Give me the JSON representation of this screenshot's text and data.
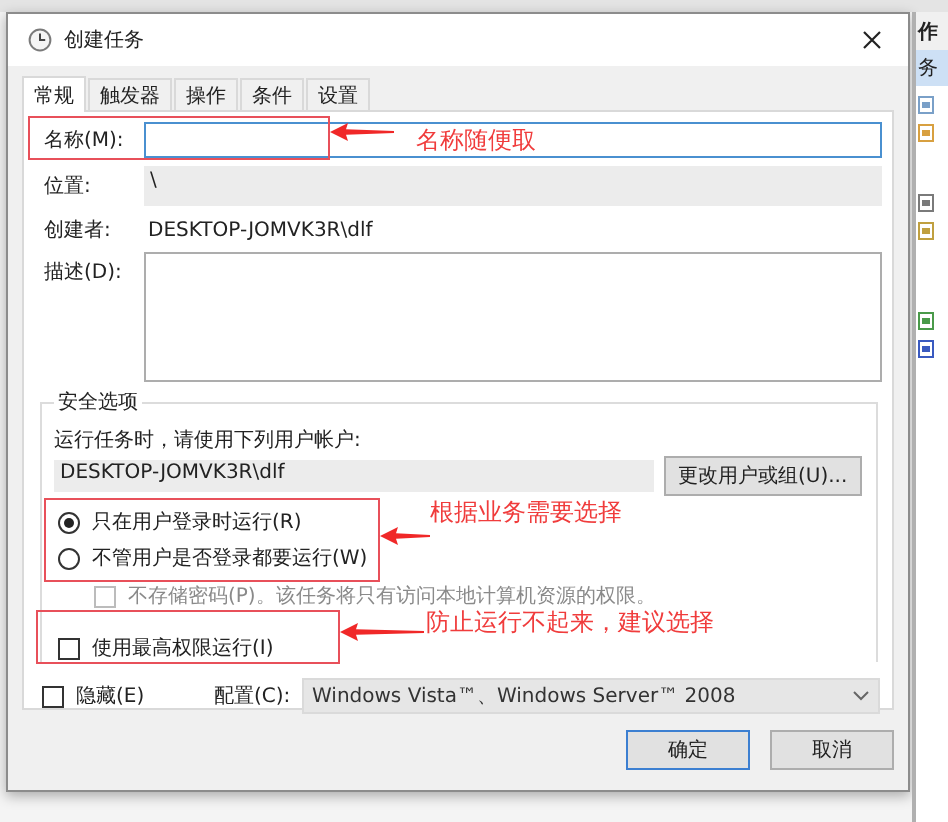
{
  "window": {
    "title": "创建任务"
  },
  "tabs": [
    {
      "label": "常规",
      "selected": true
    },
    {
      "label": "触发器",
      "selected": false
    },
    {
      "label": "操作",
      "selected": false
    },
    {
      "label": "条件",
      "selected": false
    },
    {
      "label": "设置",
      "selected": false
    }
  ],
  "name": {
    "label": "名称(M):",
    "focused": true
  },
  "location": {
    "label": "位置:",
    "value": "\\"
  },
  "author": {
    "label": "创建者:",
    "value": "DESKTOP-JOMVK3R\\dlf"
  },
  "description": {
    "label": "描述(D):"
  },
  "security": {
    "title": "安全选项",
    "prompt": "运行任务时，请使用下列用户帐户:",
    "account": "DESKTOP-JOMVK3R\\dlf",
    "change_button": "更改用户或组(U)...",
    "options": [
      {
        "kind": "radio",
        "label": "只在用户登录时运行(R)",
        "selected": true,
        "disabled": false
      },
      {
        "kind": "radio",
        "label": "不管用户是否登录都要运行(W)",
        "selected": false,
        "disabled": false
      },
      {
        "kind": "checkbox",
        "label": "不存储密码(P)。该任务将只有访问本地计算机资源的权限。",
        "checked": false,
        "disabled": true
      },
      {
        "kind": "checkbox",
        "label": "使用最高权限运行(I)",
        "checked": false,
        "disabled": false
      }
    ]
  },
  "hidden": {
    "label": "隐藏(E)",
    "checked": false
  },
  "configure": {
    "label": "配置(C):",
    "value": "Windows Vista™、Windows Server™ 2008"
  },
  "buttons": [
    {
      "label": "确定",
      "default": true
    },
    {
      "label": "取消",
      "default": false
    }
  ],
  "annotations": [
    {
      "text": "名称随便取"
    },
    {
      "text": "根据业务需要选择"
    },
    {
      "text": "防止运行不起来，建议选择"
    }
  ],
  "background_window": {
    "texts": [
      "作",
      "务"
    ]
  }
}
